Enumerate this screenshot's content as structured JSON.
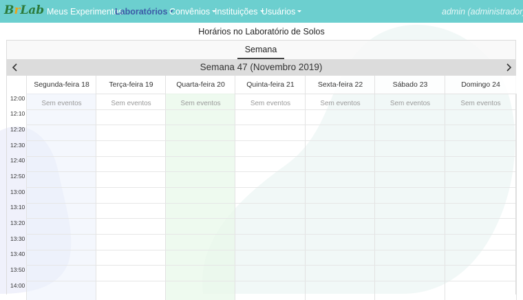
{
  "app": {
    "logo": {
      "part1": "B",
      "part2": "r",
      "part3": "Lab"
    }
  },
  "navbar": {
    "items": [
      {
        "label": "Meus Experimentos",
        "dropdown": false,
        "active": false
      },
      {
        "label": "Laboratórios",
        "dropdown": true,
        "active": true
      },
      {
        "label": "Convênios",
        "dropdown": true,
        "active": false
      },
      {
        "label": "Instituições",
        "dropdown": true,
        "active": false
      },
      {
        "label": "Usuários",
        "dropdown": true,
        "active": false
      }
    ],
    "user": "admin (administrador)"
  },
  "page": {
    "title": "Horários no Laboratório de Solos"
  },
  "calendar": {
    "view_tab": "Semana",
    "week_title": "Semana 47 (Novembro 2019)",
    "days": [
      {
        "label": "Segunda-feira 18",
        "empty": "Sem eventos"
      },
      {
        "label": "Terça-feira 19",
        "empty": "Sem eventos"
      },
      {
        "label": "Quarta-feira 20",
        "empty": "Sem eventos"
      },
      {
        "label": "Quinta-feira 21",
        "empty": "Sem eventos"
      },
      {
        "label": "Sexta-feira 22",
        "empty": "Sem eventos"
      },
      {
        "label": "Sábado 23",
        "empty": "Sem eventos"
      },
      {
        "label": "Domingo 24",
        "empty": "Sem eventos"
      }
    ],
    "times": [
      "12:00",
      "12:10",
      "12:20",
      "12:30",
      "12:40",
      "12:50",
      "13:00",
      "13:10",
      "13:20",
      "13:30",
      "13:40",
      "13:50",
      "14:00"
    ]
  },
  "colors": {
    "navbar": "#6ccfcf",
    "active_nav": "#3c5aa6",
    "week_bar": "#dcdcdc",
    "today_tint": "#e8f8ea"
  }
}
